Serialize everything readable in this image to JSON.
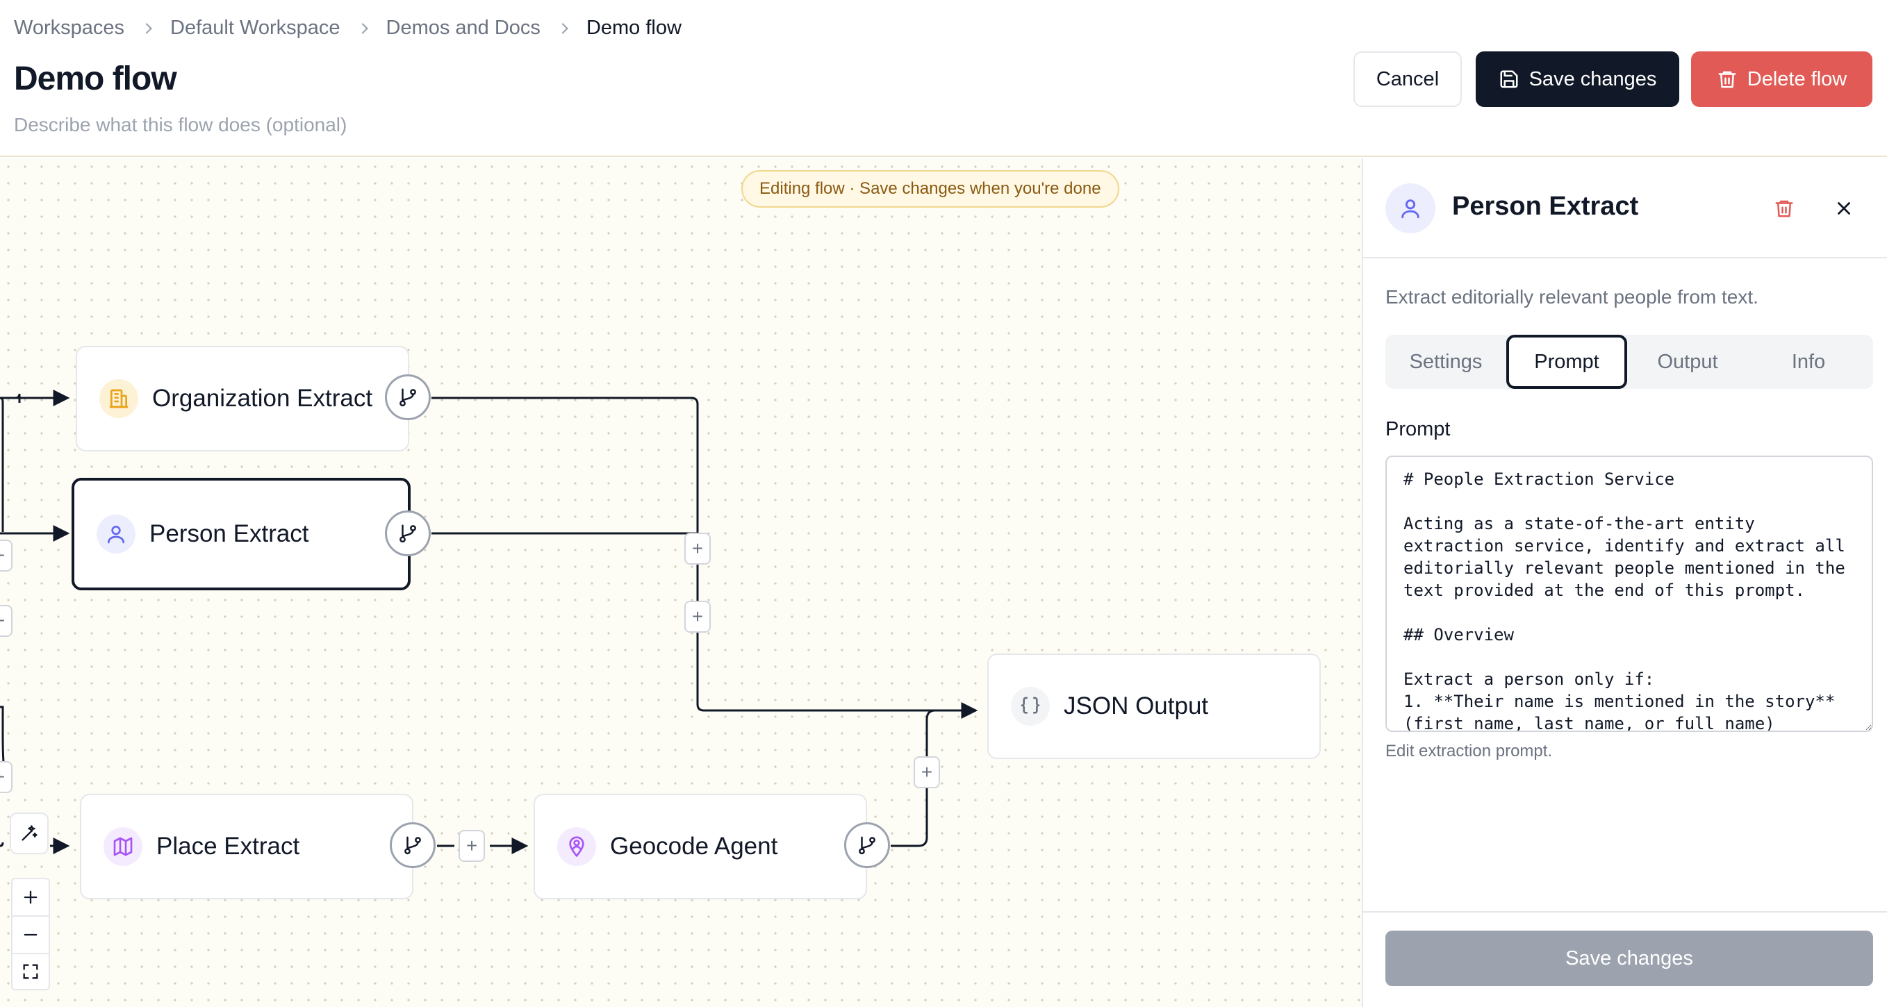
{
  "breadcrumb": [
    "Workspaces",
    "Default Workspace",
    "Demos and Docs",
    "Demo flow"
  ],
  "page": {
    "title": "Demo flow",
    "description_placeholder": "Describe what this flow does (optional)"
  },
  "header_buttons": {
    "cancel": "Cancel",
    "save": "Save changes",
    "delete": "Delete flow"
  },
  "canvas": {
    "banner": "Editing flow · Save changes when you're done",
    "nodes": {
      "organization": {
        "label": "Organization Extract",
        "icon": "building-icon",
        "color": "#e8a317"
      },
      "person": {
        "label": "Person Extract",
        "icon": "user-icon",
        "color": "#6366f1"
      },
      "json": {
        "label": "JSON Output",
        "icon": "braces-icon",
        "color": "#6b7280"
      },
      "place": {
        "label": "Place Extract",
        "icon": "map-icon",
        "color": "#a855f7"
      },
      "geocode": {
        "label": "Geocode Agent",
        "icon": "map-pin-user-icon",
        "color": "#a855f7"
      }
    },
    "plus_symbol": "+",
    "controls": [
      "zoom-in",
      "zoom-out",
      "fit-view"
    ]
  },
  "panel": {
    "title": "Person Extract",
    "description": "Extract editorially relevant people from text.",
    "tabs": [
      "Settings",
      "Prompt",
      "Output",
      "Info"
    ],
    "active_tab": "Prompt",
    "prompt_label": "Prompt",
    "prompt_text": "# People Extraction Service\n\nActing as a state-of-the-art entity extraction service, identify and extract all editorially relevant people mentioned in the text provided at the end of this prompt.\n\n## Overview\n\nExtract a person only if:\n1. **Their name is mentioned in the story** (first name, last name, or full name)",
    "help_text": "Edit extraction prompt.",
    "save_button": "Save changes"
  },
  "colors": {
    "primary": "#111827",
    "danger": "#e15a55",
    "banner_bg": "#fef8e4",
    "disabled": "#9ca3af"
  }
}
